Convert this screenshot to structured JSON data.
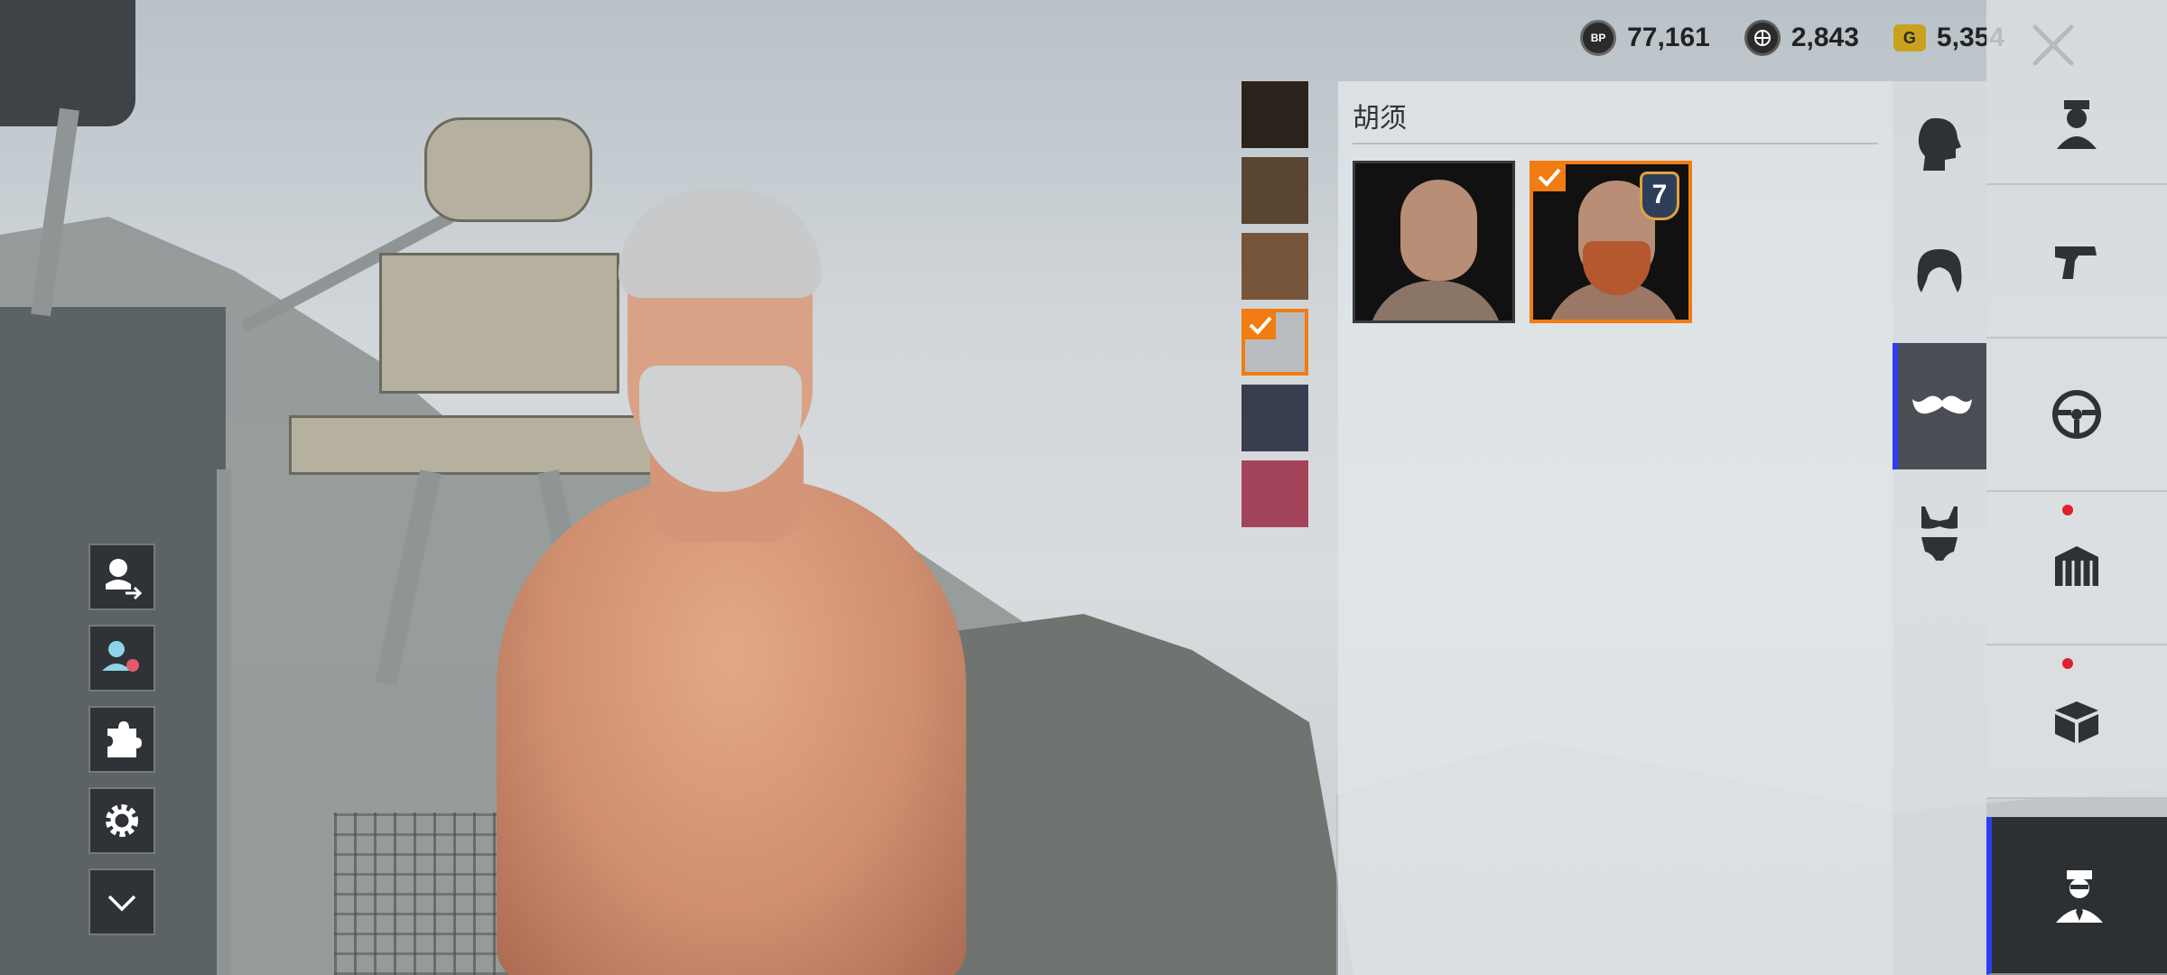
{
  "currencies": [
    {
      "icon": "bp-coin-icon",
      "symbol": "BP",
      "value": "77,161"
    },
    {
      "icon": "uc-coin-icon",
      "symbol": "",
      "value": "2,843"
    },
    {
      "icon": "g-coin-icon",
      "symbol": "G",
      "value": "5,354"
    }
  ],
  "panel": {
    "title": "胡须",
    "items": [
      {
        "name": "no-beard",
        "selected": false
      },
      {
        "name": "full-beard",
        "selected": true,
        "rank": "7"
      }
    ]
  },
  "swatches": [
    {
      "color": "#2a231c",
      "selected": false
    },
    {
      "color": "#5a4532",
      "selected": false
    },
    {
      "color": "#76553a",
      "selected": false
    },
    {
      "color": "#b9bcbf",
      "selected": true
    },
    {
      "color": "#383d4f",
      "selected": false
    },
    {
      "color": "#a3445a",
      "selected": false
    }
  ],
  "left_tools": [
    "character-swap-icon",
    "appearance-icon",
    "puzzle-icon",
    "gear-icon",
    "chevron-down-icon"
  ],
  "category_tabs": [
    "head-icon",
    "hair-icon",
    "mustache-icon",
    "swimwear-icon"
  ],
  "active_category": "mustache-icon",
  "outer_tabs": [
    {
      "icon": "character-icon",
      "badge": false
    },
    {
      "icon": "pistol-icon",
      "badge": false
    },
    {
      "icon": "steering-wheel-icon",
      "badge": false
    },
    {
      "icon": "crate-icon",
      "badge": true
    },
    {
      "icon": "box-icon",
      "badge": true
    },
    {
      "icon": "agent-icon",
      "badge": false,
      "active": true
    }
  ],
  "accent": "#f07c12",
  "active_indicator": "#2e3df0"
}
